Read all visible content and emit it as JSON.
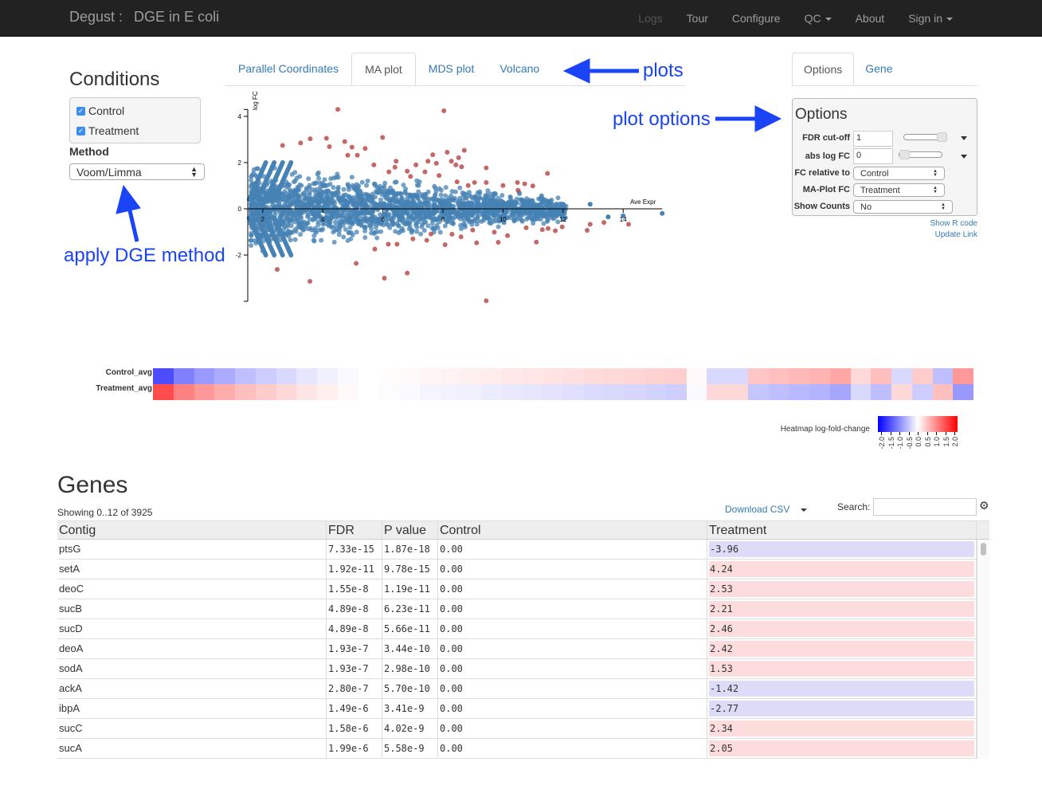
{
  "nav": {
    "brand": "Degust :",
    "title": "DGE in E coli",
    "items": [
      {
        "label": "Logs",
        "dim": true
      },
      {
        "label": "Tour"
      },
      {
        "label": "Configure"
      },
      {
        "label": "QC",
        "caret": true
      },
      {
        "label": "About"
      },
      {
        "label": "Sign in",
        "caret": true
      }
    ]
  },
  "conditions": {
    "title": "Conditions",
    "items": [
      {
        "label": "Control",
        "checked": true
      },
      {
        "label": "Treatment",
        "checked": true
      }
    ],
    "method_label": "Method",
    "method_value": "Voom/Limma"
  },
  "plot_tabs": [
    {
      "label": "Parallel Coordinates"
    },
    {
      "label": "MA plot",
      "active": true
    },
    {
      "label": "MDS plot"
    },
    {
      "label": "Volcano"
    }
  ],
  "annotations": {
    "plots": "plots",
    "plot_options": "plot options",
    "apply": "apply DGE method",
    "color": "#1a44f5"
  },
  "options_tabs": [
    {
      "label": "Options",
      "active": true
    },
    {
      "label": "Gene"
    }
  ],
  "options": {
    "title": "Options",
    "fdr_label": "FDR cut-off",
    "fdr_value": "1",
    "fdr_slider": 1.0,
    "abslogfc_label": "abs log FC",
    "abslogfc_value": "0",
    "abslogfc_slider": 0.0,
    "fc_rel_label": "FC relative to",
    "fc_rel_value": "Control",
    "maplot_label": "MA-Plot FC",
    "maplot_value": "Treatment",
    "counts_label": "Show Counts",
    "counts_value": "No",
    "show_r_code": "Show R code",
    "update_link": "Update Link"
  },
  "chart_data": {
    "type": "scatter",
    "title": "",
    "xlabel": "Ave Expr",
    "ylabel": "log FC",
    "xlim": [
      1.5,
      15.3
    ],
    "ylim": [
      -4,
      5
    ],
    "xticks": [
      2,
      4,
      6,
      8,
      10,
      12,
      14
    ],
    "yticks": [
      4,
      2,
      0,
      -2
    ],
    "colors": {
      "non_significant": "#4682b4",
      "significant": "#b84c4c"
    },
    "significant_points": [
      [
        4.5,
        4.3
      ],
      [
        8.03,
        4.24
      ],
      [
        5.99,
        3.09
      ],
      [
        3.58,
        3.03
      ],
      [
        4.12,
        3.05
      ],
      [
        3.26,
        2.85
      ],
      [
        2.66,
        2.74
      ],
      [
        4.73,
        2.91
      ],
      [
        4.97,
        2.67
      ],
      [
        4.22,
        2.69
      ],
      [
        5.41,
        2.61
      ],
      [
        5.15,
        2.32
      ],
      [
        4.83,
        2.32
      ],
      [
        8.71,
        2.53
      ],
      [
        8.14,
        2.45
      ],
      [
        7.66,
        2.34
      ],
      [
        8.52,
        2.21
      ],
      [
        6.44,
        2.06
      ],
      [
        7.5,
        2.06
      ],
      [
        7.78,
        1.97
      ],
      [
        8.28,
        2.06
      ],
      [
        8.43,
        1.9
      ],
      [
        8.62,
        1.82
      ],
      [
        7.1,
        1.9
      ],
      [
        5.7,
        1.9
      ],
      [
        6.4,
        1.8
      ],
      [
        9.44,
        1.77
      ],
      [
        11.48,
        1.53
      ],
      [
        7.4,
        1.6
      ],
      [
        6.81,
        1.63
      ],
      [
        6.2,
        1.6
      ],
      [
        7.87,
        1.44
      ],
      [
        6.92,
        1.4
      ],
      [
        9.44,
        1.14
      ],
      [
        9.05,
        1.14
      ],
      [
        10.48,
        1.14
      ],
      [
        10.72,
        1.08
      ],
      [
        10.99,
        0.99
      ],
      [
        10.0,
        1.01
      ],
      [
        8.84,
        1.01
      ],
      [
        10.5,
        0.8
      ],
      [
        8.47,
        1.17
      ],
      [
        3.57,
        -3.14
      ],
      [
        6.05,
        -3.0
      ],
      [
        6.81,
        -2.78
      ],
      [
        5.11,
        -2.36
      ],
      [
        9.44,
        -3.98
      ],
      [
        2.48,
        -2.62
      ],
      [
        11.11,
        -1.44
      ],
      [
        8.07,
        -1.55
      ],
      [
        9.12,
        -1.47
      ],
      [
        9.84,
        -1.45
      ],
      [
        10.15,
        -1.16
      ],
      [
        8.3,
        -1.1
      ],
      [
        7.46,
        -1.36
      ],
      [
        6.47,
        -1.53
      ],
      [
        6.18,
        -1.53
      ],
      [
        10.77,
        -0.82
      ],
      [
        11.31,
        -0.9
      ],
      [
        11.74,
        -0.95
      ],
      [
        11.97,
        -0.78
      ],
      [
        12.8,
        -0.93
      ],
      [
        13.36,
        -0.59
      ],
      [
        14.18,
        -0.67
      ],
      [
        12.9,
        -0.67
      ],
      [
        11.5,
        -0.85
      ],
      [
        9.71,
        -1.01
      ],
      [
        8.99,
        -0.92
      ],
      [
        8.6,
        -1.21
      ],
      [
        7.6,
        -1.09
      ],
      [
        7.0,
        -1.3
      ],
      [
        5.73,
        -1.74
      ]
    ],
    "outlier_points": [
      [
        15.3,
        -0.2
      ],
      [
        14.0,
        -0.3
      ],
      [
        13.5,
        -0.35
      ],
      [
        12.9,
        0.2
      ],
      [
        12.0,
        0.2
      ]
    ]
  },
  "heatmap": {
    "rows": [
      "Control_avg",
      "Treatment_avg"
    ],
    "legend_label": "Heatmap log-fold-change",
    "legend_ticks": [
      "-2.0",
      "-1.5",
      "-1.0",
      "-0.5",
      "0.0",
      "0.5",
      "1.0",
      "1.5",
      "2.0"
    ],
    "low_color": "#0000ff",
    "mid_color": "#ffffff",
    "high_color": "#ff0000",
    "control_values": [
      -1.4,
      -1.0,
      -0.8,
      -0.65,
      -0.5,
      -0.4,
      -0.3,
      -0.2,
      -0.12,
      -0.05,
      0.0,
      0.02,
      0.05,
      0.08,
      0.1,
      0.12,
      0.15,
      0.18,
      0.2,
      0.22,
      0.25,
      0.28,
      0.3,
      0.32,
      0.35,
      0.38,
      0.05,
      -0.3,
      -0.3,
      0.45,
      0.5,
      0.55,
      0.6,
      0.7,
      0.3,
      0.5,
      -0.3,
      0.4,
      -0.5,
      0.8
    ]
  },
  "genes": {
    "title": "Genes",
    "showing": "Showing 0..12 of 3925",
    "download": "Download CSV",
    "search_label": "Search:",
    "search_value": "",
    "columns": [
      "Contig",
      "FDR",
      "P value",
      "Control",
      "Treatment"
    ],
    "rows": [
      [
        "ptsG",
        "7.33e-15",
        "1.87e-18",
        "0.00",
        "-3.96"
      ],
      [
        "setA",
        "1.92e-11",
        "9.78e-15",
        "0.00",
        "4.24"
      ],
      [
        "deoC",
        "1.55e-8",
        "1.19e-11",
        "0.00",
        "2.53"
      ],
      [
        "sucB",
        "4.89e-8",
        "6.23e-11",
        "0.00",
        "2.21"
      ],
      [
        "sucD",
        "4.89e-8",
        "5.66e-11",
        "0.00",
        "2.46"
      ],
      [
        "deoA",
        "1.93e-7",
        "3.44e-10",
        "0.00",
        "2.42"
      ],
      [
        "sodA",
        "1.93e-7",
        "2.98e-10",
        "0.00",
        "1.53"
      ],
      [
        "ackA",
        "2.80e-7",
        "5.70e-10",
        "0.00",
        "-1.42"
      ],
      [
        "ibpA",
        "1.49e-6",
        "3.41e-9",
        "0.00",
        "-2.77"
      ],
      [
        "sucC",
        "1.58e-6",
        "4.02e-9",
        "0.00",
        "2.34"
      ],
      [
        "sucA",
        "1.99e-6",
        "5.58e-9",
        "0.00",
        "2.05"
      ]
    ]
  }
}
